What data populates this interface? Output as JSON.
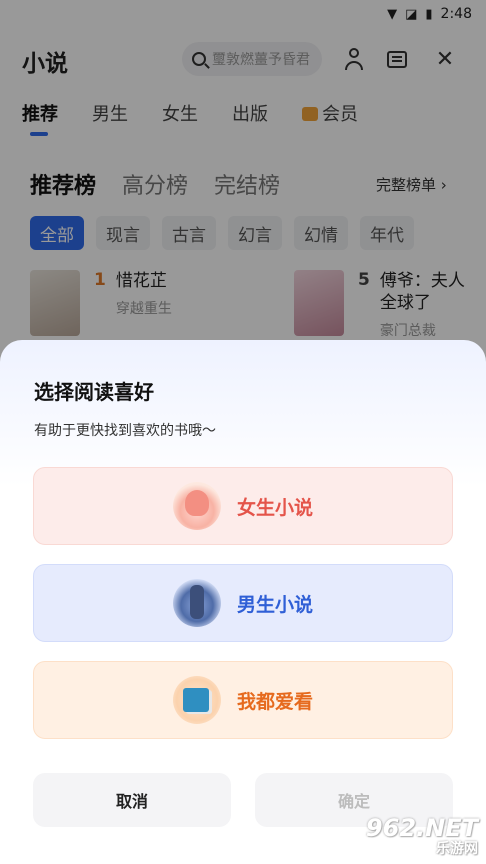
{
  "status_bar": {
    "time": "2:48"
  },
  "header": {
    "title": "小说",
    "search_placeholder": "璽敦燃薑予昏君",
    "icons": [
      "user-icon",
      "message-icon",
      "close-icon"
    ]
  },
  "top_tabs": [
    {
      "label": "推荐",
      "active": true
    },
    {
      "label": "男生"
    },
    {
      "label": "女生"
    },
    {
      "label": "出版"
    },
    {
      "label": "会员"
    }
  ],
  "ranking": {
    "tabs": [
      "推荐榜",
      "高分榜",
      "完结榜"
    ],
    "full_list_label": "完整榜单",
    "chips": [
      "全部",
      "现言",
      "古言",
      "幻言",
      "幻情",
      "年代"
    ],
    "books": [
      {
        "rank": "1",
        "title": "惜花芷",
        "subtitle": "穿越重生"
      },
      {
        "rank": "5",
        "title": "傅爷：夫人全球了",
        "subtitle": "豪门总裁"
      }
    ]
  },
  "sheet": {
    "title": "选择阅读喜好",
    "subtitle": "有助于更快找到喜欢的书哦～",
    "options": [
      {
        "label": "女生小说",
        "color": "#e4544a"
      },
      {
        "label": "男生小说",
        "color": "#2f5fd6"
      },
      {
        "label": "我都爱看",
        "color": "#e66a1e"
      }
    ],
    "cancel_label": "取消",
    "confirm_label": "确定"
  },
  "watermark": {
    "main": "962.NET",
    "sub": "乐游网"
  },
  "colors": {
    "accent": "#2f6bec",
    "rank_highlight": "#e07b2b"
  }
}
